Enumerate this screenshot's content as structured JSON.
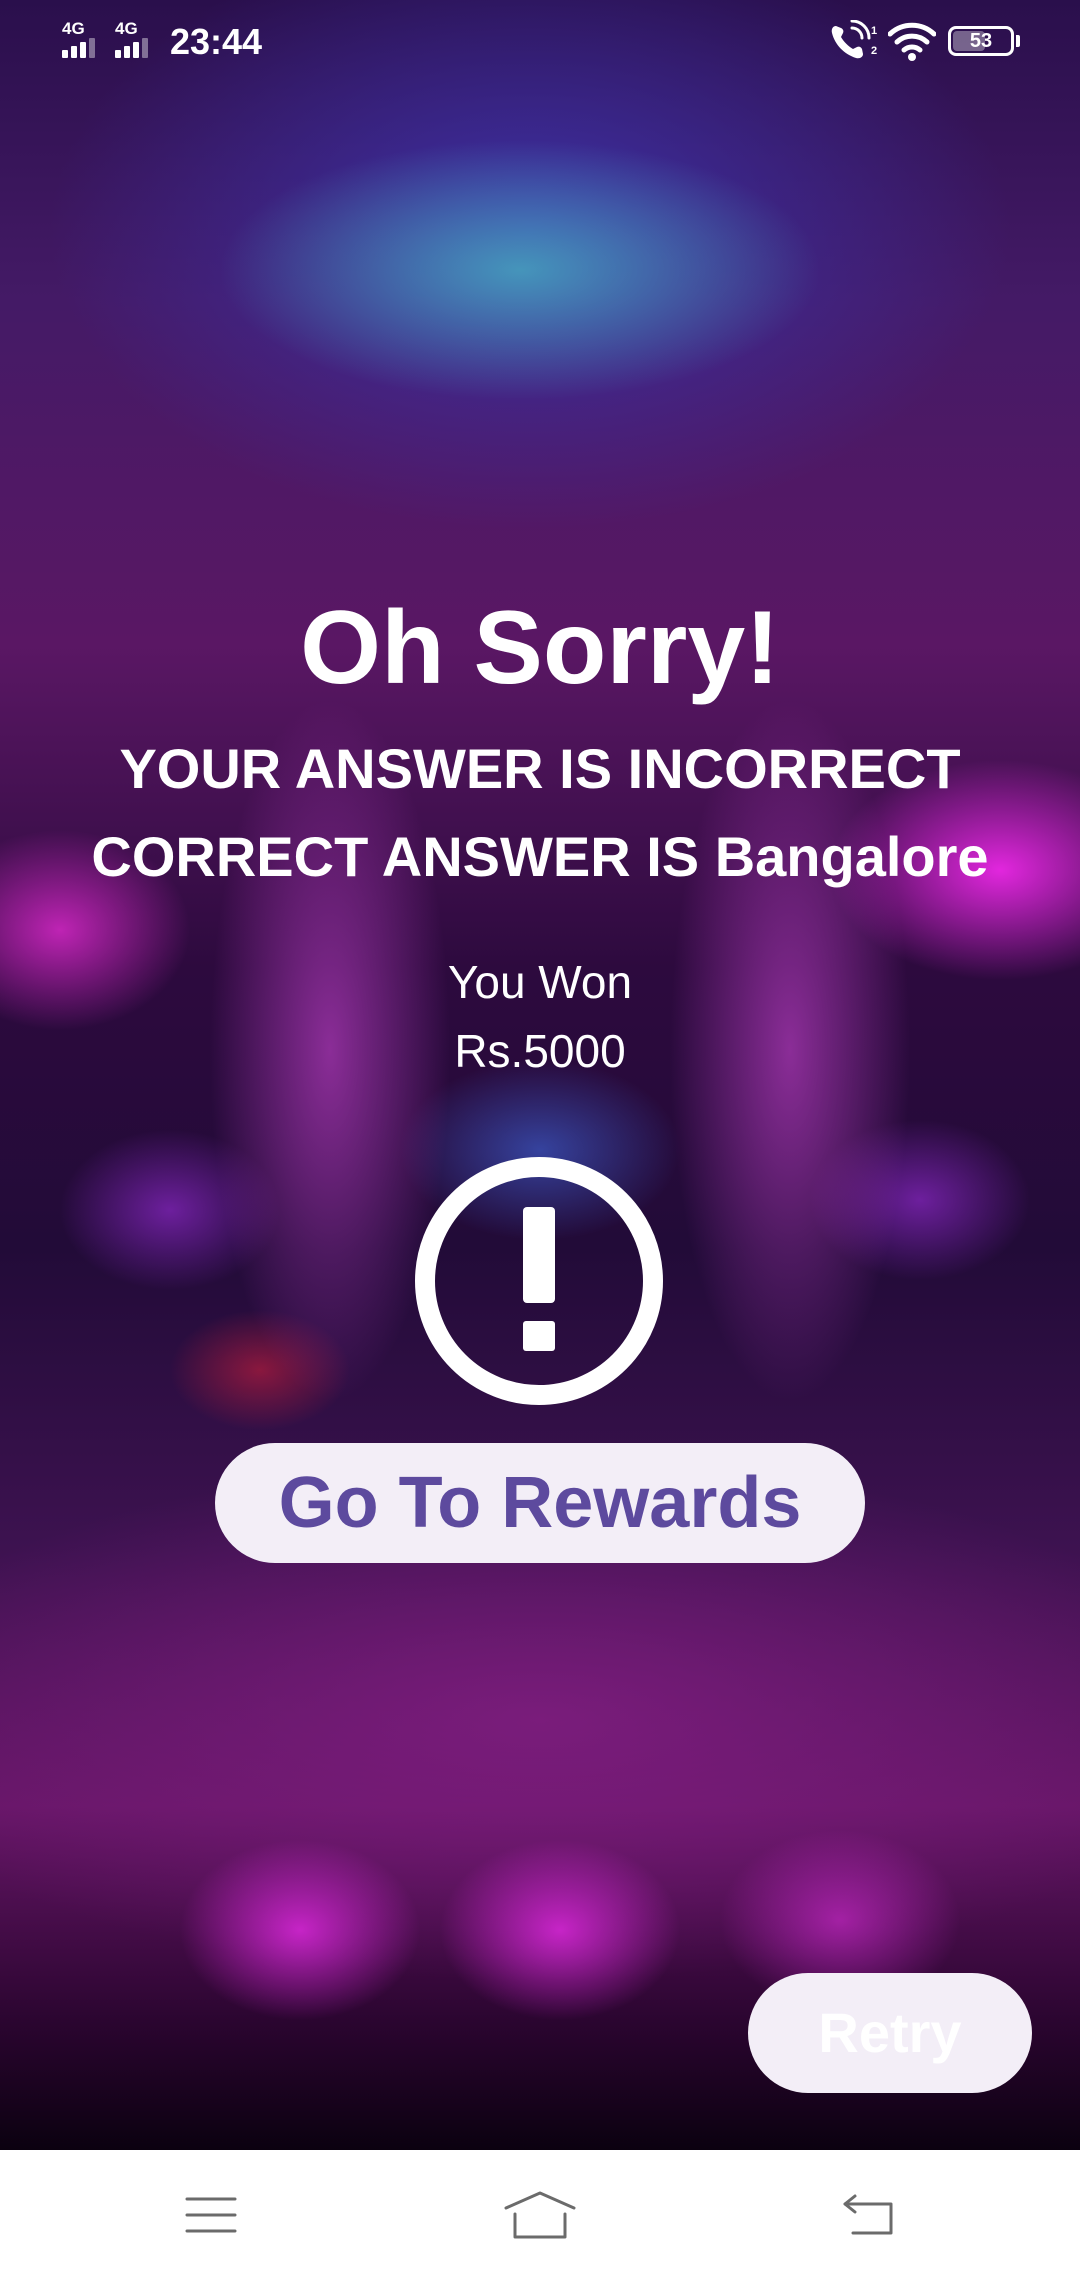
{
  "status_bar": {
    "sim1_network": "4G",
    "sim2_network": "4G",
    "time": "23:44",
    "battery_level": "53",
    "icons": [
      "signal-icon",
      "signal-icon",
      "wifi-calling-icon",
      "wifi-icon",
      "battery-icon"
    ]
  },
  "result": {
    "title": "Oh Sorry!",
    "message": "YOUR ANSWER IS INCORRECT",
    "correct_answer_prefix": "CORRECT ANSWER IS",
    "correct_answer": "Bangalore",
    "won_label": "You Won",
    "won_amount": "Rs.5000",
    "icon": "exclamation-circle-icon"
  },
  "actions": {
    "rewards_label": "Go To Rewards",
    "retry_label": "Retry"
  },
  "nav_bar": {
    "icons": [
      "menu-icon",
      "home-icon",
      "back-icon"
    ]
  },
  "colors": {
    "button_background": "#f3eef7",
    "button_text": "#5d4a9e",
    "text": "#ffffff",
    "nav_background": "#ffffff",
    "nav_icon": "#6b6b6b"
  }
}
